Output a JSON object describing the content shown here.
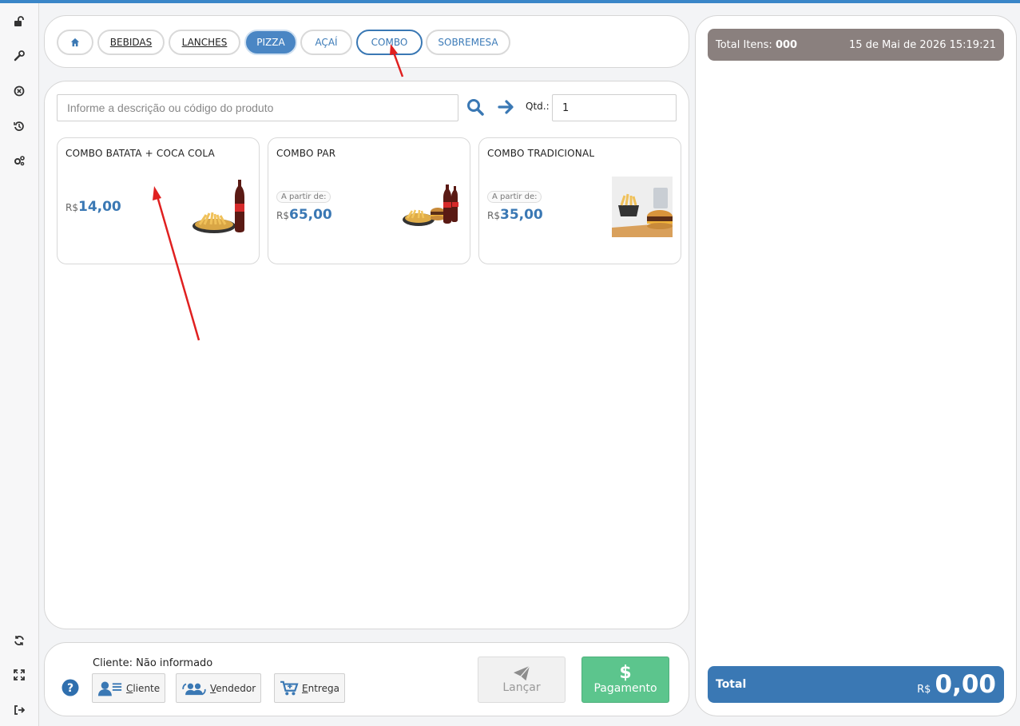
{
  "categories": [
    {
      "label": "BEBIDAS"
    },
    {
      "label": "LANCHES"
    },
    {
      "label": "PIZZA"
    },
    {
      "label": "AÇAÍ"
    },
    {
      "label": "COMBO"
    },
    {
      "label": "SOBREMESA"
    }
  ],
  "search": {
    "placeholder": "Informe a descrição ou código do produto",
    "qty_label": "Qtd.:",
    "qty_value": "1"
  },
  "products": [
    {
      "name": "COMBO BATATA + COCA COLA",
      "from_label": "",
      "currency": "R$",
      "price": "14,00"
    },
    {
      "name": "COMBO PAR",
      "from_label": "A partir de:",
      "currency": "R$",
      "price": "65,00"
    },
    {
      "name": "COMBO TRADICIONAL",
      "from_label": "A partir de:",
      "currency": "R$",
      "price": "35,00"
    }
  ],
  "bottom": {
    "client_status": "Cliente: Não informado",
    "cliente_label": "Cliente",
    "vendedor_label": "Vendedor",
    "entrega_label": "Entrega",
    "lancar_label": "Lançar",
    "pagamento_label": "Pagamento",
    "pagamento_symbol": "$"
  },
  "cart": {
    "total_items_label": "Total Itens:",
    "total_items_value": "000",
    "datetime": "15 de Mai de 2026 15:19:21",
    "total_label": "Total",
    "total_currency": "R$",
    "total_value": "0,00"
  },
  "colors": {
    "accent": "#3a78b4",
    "success": "#5cc58d",
    "header_gray": "#8a807e",
    "annotation": "#e02020"
  },
  "icons": [
    "unlock-icon",
    "wrench-icon",
    "cancel-icon",
    "history-icon",
    "settings-icon",
    "refresh-icon",
    "fullscreen-icon",
    "logout-icon",
    "home-icon",
    "search-icon",
    "arrow-right-icon",
    "help-icon",
    "user-list-icon",
    "users-swap-icon",
    "cart-plus-icon",
    "paper-plane-icon"
  ]
}
